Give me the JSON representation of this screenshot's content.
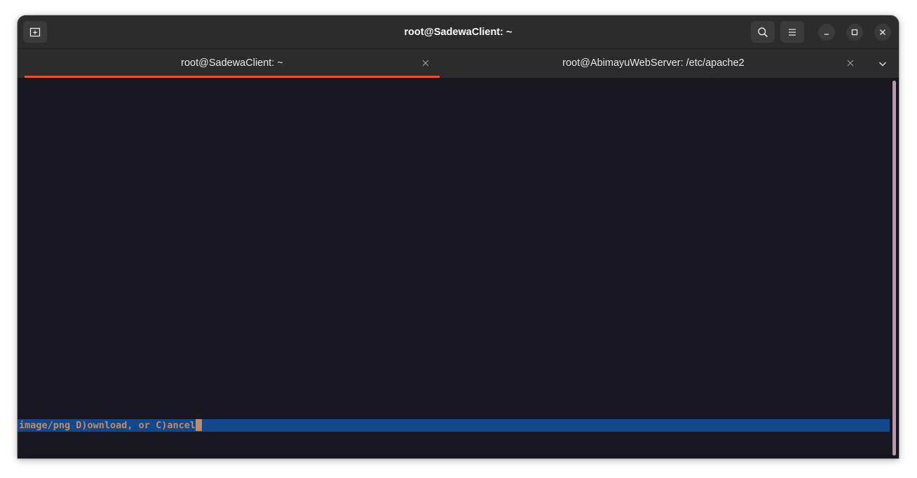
{
  "window": {
    "title": "root@SadewaClient: ~"
  },
  "headerbar": {
    "new_tab_icon": "new-tab-icon",
    "search_icon": "search-icon",
    "menu_icon": "hamburger-menu-icon",
    "minimize_icon": "minimize-icon",
    "maximize_icon": "maximize-icon",
    "close_icon": "close-icon"
  },
  "tabs": [
    {
      "label": "root@SadewaClient: ~",
      "active": true
    },
    {
      "label": "root@AbimayuWebServer: /etc/apache2",
      "active": false
    }
  ],
  "tab_overflow_icon": "chevron-down-icon",
  "terminal": {
    "status_line": "image/png D)ownload, or C)ancel"
  },
  "colors": {
    "accent": "#e95420",
    "terminal_bg": "#181620",
    "headerbar_bg": "#2c2c2c",
    "status_bg": "#12488b",
    "status_fg": "#c38a66"
  }
}
